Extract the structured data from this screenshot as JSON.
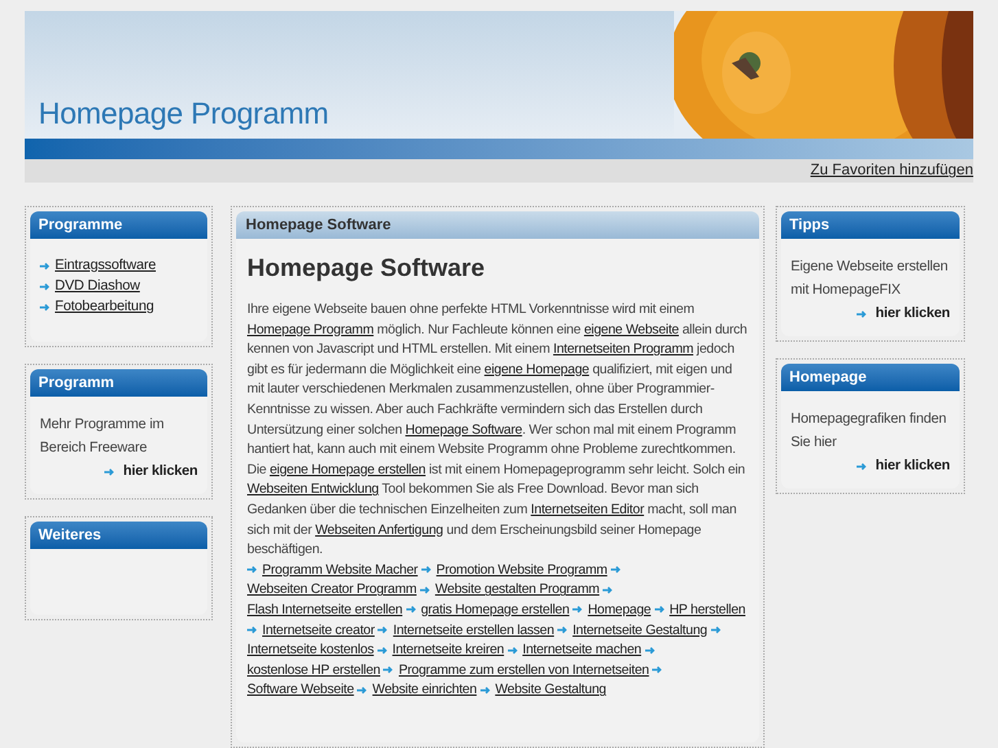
{
  "header": {
    "title": "Homepage Programm",
    "favorites_link": "Zu Favoriten hinzufügen"
  },
  "left_boxes": [
    {
      "title": "Programme",
      "kind": "links",
      "links": [
        "Eintragssoftware",
        "DVD Diashow",
        "Fotobearbeitung"
      ]
    },
    {
      "title": "Programm",
      "kind": "text",
      "text": "Mehr Programme im Bereich Freeware",
      "more": "hier klicken"
    },
    {
      "title": "Weiteres",
      "kind": "empty"
    }
  ],
  "main": {
    "tab_title": "Homepage Software",
    "heading": "Homepage Software",
    "body": [
      {
        "text": "Ihre eigene Webseite bauen ohne perfekte HTML Vorkenntnisse wird mit einem ",
        "link": false
      },
      {
        "text": "Homepage Programm",
        "link": true
      },
      {
        "text": " möglich. Nur Fachleute können eine ",
        "link": false
      },
      {
        "text": "eigene Webseite",
        "link": true
      },
      {
        "text": " allein durch kennen von Javascript und HTML erstellen. Mit einem ",
        "link": false
      },
      {
        "text": "Internetseiten Programm",
        "link": true
      },
      {
        "text": " jedoch gibt es für jedermann die Möglichkeit eine ",
        "link": false
      },
      {
        "text": "eigene Homepage",
        "link": true
      },
      {
        "text": " qualifiziert, mit eigen und mit lauter verschiedenen Merkmalen zusammenzustellen, ohne über Programmier-Kenntnisse zu wissen. Aber auch Fachkräfte vermindern sich das Erstellen durch Untersützung einer solchen ",
        "link": false
      },
      {
        "text": "Homepage Software",
        "link": true
      },
      {
        "text": ". Wer schon mal mit einem Programm hantiert hat, kann auch mit einem Website Programm ohne Probleme zurechtkommen. Die ",
        "link": false
      },
      {
        "text": "eigene Homepage erstellen",
        "link": true
      },
      {
        "text": " ist mit einem Homepageprogramm sehr leicht. Solch ein ",
        "link": false
      },
      {
        "text": "Webseiten Entwicklung",
        "link": true
      },
      {
        "text": " Tool bekommen Sie als Free Download. Bevor man sich Gedanken über die technischen Einzelheiten zum ",
        "link": false
      },
      {
        "text": "Internetseiten Editor",
        "link": true
      },
      {
        "text": " macht, soll man sich mit der ",
        "link": false
      },
      {
        "text": "Webseiten Anfertigung",
        "link": true
      },
      {
        "text": "  und dem Erscheinungsbild seiner Homepage beschäftigen.",
        "link": false
      }
    ],
    "related_links": [
      "Programm Website Macher",
      "Promotion Website Programm",
      "Webseiten Creator Programm",
      "Website gestalten Programm",
      "Flash Internetseite erstellen",
      "gratis Homepage erstellen",
      "Homepage",
      "HP herstellen",
      "Internetseite creator",
      "Internetseite erstellen lassen",
      "Internetseite Gestaltung",
      "Internetseite kostenlos",
      "Internetseite kreiren",
      "Internetseite machen",
      "kostenlose HP erstellen",
      "Programme zum erstellen von Internetseiten",
      "Software Webseite",
      "Website einrichten",
      "Website Gestaltung"
    ]
  },
  "right_boxes": [
    {
      "title": "Tipps",
      "kind": "text",
      "text": "Eigene Webseite erstellen mit HomepageFIX",
      "more": "hier klicken"
    },
    {
      "title": "Homepage",
      "kind": "text",
      "text": "Homepagegrafiken finden Sie hier",
      "more": "hier klicken"
    }
  ]
}
